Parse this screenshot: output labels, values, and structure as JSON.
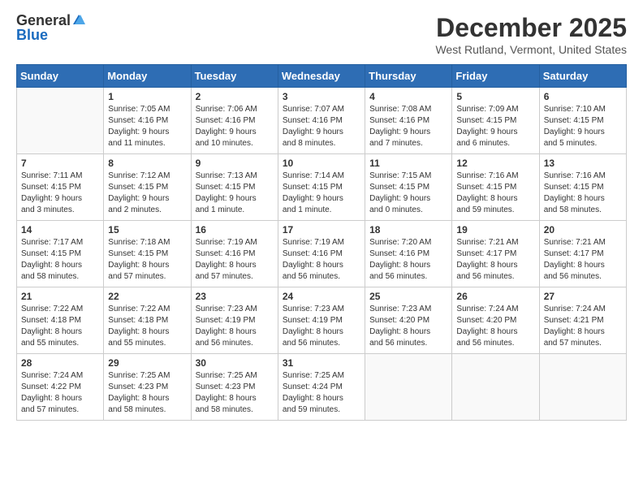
{
  "header": {
    "logo_general": "General",
    "logo_blue": "Blue",
    "month_title": "December 2025",
    "subtitle": "West Rutland, Vermont, United States"
  },
  "days_of_week": [
    "Sunday",
    "Monday",
    "Tuesday",
    "Wednesday",
    "Thursday",
    "Friday",
    "Saturday"
  ],
  "weeks": [
    [
      {
        "day": "",
        "text": ""
      },
      {
        "day": "1",
        "text": "Sunrise: 7:05 AM\nSunset: 4:16 PM\nDaylight: 9 hours\nand 11 minutes."
      },
      {
        "day": "2",
        "text": "Sunrise: 7:06 AM\nSunset: 4:16 PM\nDaylight: 9 hours\nand 10 minutes."
      },
      {
        "day": "3",
        "text": "Sunrise: 7:07 AM\nSunset: 4:16 PM\nDaylight: 9 hours\nand 8 minutes."
      },
      {
        "day": "4",
        "text": "Sunrise: 7:08 AM\nSunset: 4:16 PM\nDaylight: 9 hours\nand 7 minutes."
      },
      {
        "day": "5",
        "text": "Sunrise: 7:09 AM\nSunset: 4:15 PM\nDaylight: 9 hours\nand 6 minutes."
      },
      {
        "day": "6",
        "text": "Sunrise: 7:10 AM\nSunset: 4:15 PM\nDaylight: 9 hours\nand 5 minutes."
      }
    ],
    [
      {
        "day": "7",
        "text": "Sunrise: 7:11 AM\nSunset: 4:15 PM\nDaylight: 9 hours\nand 3 minutes."
      },
      {
        "day": "8",
        "text": "Sunrise: 7:12 AM\nSunset: 4:15 PM\nDaylight: 9 hours\nand 2 minutes."
      },
      {
        "day": "9",
        "text": "Sunrise: 7:13 AM\nSunset: 4:15 PM\nDaylight: 9 hours\nand 1 minute."
      },
      {
        "day": "10",
        "text": "Sunrise: 7:14 AM\nSunset: 4:15 PM\nDaylight: 9 hours\nand 1 minute."
      },
      {
        "day": "11",
        "text": "Sunrise: 7:15 AM\nSunset: 4:15 PM\nDaylight: 9 hours\nand 0 minutes."
      },
      {
        "day": "12",
        "text": "Sunrise: 7:16 AM\nSunset: 4:15 PM\nDaylight: 8 hours\nand 59 minutes."
      },
      {
        "day": "13",
        "text": "Sunrise: 7:16 AM\nSunset: 4:15 PM\nDaylight: 8 hours\nand 58 minutes."
      }
    ],
    [
      {
        "day": "14",
        "text": "Sunrise: 7:17 AM\nSunset: 4:15 PM\nDaylight: 8 hours\nand 58 minutes."
      },
      {
        "day": "15",
        "text": "Sunrise: 7:18 AM\nSunset: 4:15 PM\nDaylight: 8 hours\nand 57 minutes."
      },
      {
        "day": "16",
        "text": "Sunrise: 7:19 AM\nSunset: 4:16 PM\nDaylight: 8 hours\nand 57 minutes."
      },
      {
        "day": "17",
        "text": "Sunrise: 7:19 AM\nSunset: 4:16 PM\nDaylight: 8 hours\nand 56 minutes."
      },
      {
        "day": "18",
        "text": "Sunrise: 7:20 AM\nSunset: 4:16 PM\nDaylight: 8 hours\nand 56 minutes."
      },
      {
        "day": "19",
        "text": "Sunrise: 7:21 AM\nSunset: 4:17 PM\nDaylight: 8 hours\nand 56 minutes."
      },
      {
        "day": "20",
        "text": "Sunrise: 7:21 AM\nSunset: 4:17 PM\nDaylight: 8 hours\nand 56 minutes."
      }
    ],
    [
      {
        "day": "21",
        "text": "Sunrise: 7:22 AM\nSunset: 4:18 PM\nDaylight: 8 hours\nand 55 minutes."
      },
      {
        "day": "22",
        "text": "Sunrise: 7:22 AM\nSunset: 4:18 PM\nDaylight: 8 hours\nand 55 minutes."
      },
      {
        "day": "23",
        "text": "Sunrise: 7:23 AM\nSunset: 4:19 PM\nDaylight: 8 hours\nand 56 minutes."
      },
      {
        "day": "24",
        "text": "Sunrise: 7:23 AM\nSunset: 4:19 PM\nDaylight: 8 hours\nand 56 minutes."
      },
      {
        "day": "25",
        "text": "Sunrise: 7:23 AM\nSunset: 4:20 PM\nDaylight: 8 hours\nand 56 minutes."
      },
      {
        "day": "26",
        "text": "Sunrise: 7:24 AM\nSunset: 4:20 PM\nDaylight: 8 hours\nand 56 minutes."
      },
      {
        "day": "27",
        "text": "Sunrise: 7:24 AM\nSunset: 4:21 PM\nDaylight: 8 hours\nand 57 minutes."
      }
    ],
    [
      {
        "day": "28",
        "text": "Sunrise: 7:24 AM\nSunset: 4:22 PM\nDaylight: 8 hours\nand 57 minutes."
      },
      {
        "day": "29",
        "text": "Sunrise: 7:25 AM\nSunset: 4:23 PM\nDaylight: 8 hours\nand 58 minutes."
      },
      {
        "day": "30",
        "text": "Sunrise: 7:25 AM\nSunset: 4:23 PM\nDaylight: 8 hours\nand 58 minutes."
      },
      {
        "day": "31",
        "text": "Sunrise: 7:25 AM\nSunset: 4:24 PM\nDaylight: 8 hours\nand 59 minutes."
      },
      {
        "day": "",
        "text": ""
      },
      {
        "day": "",
        "text": ""
      },
      {
        "day": "",
        "text": ""
      }
    ]
  ]
}
